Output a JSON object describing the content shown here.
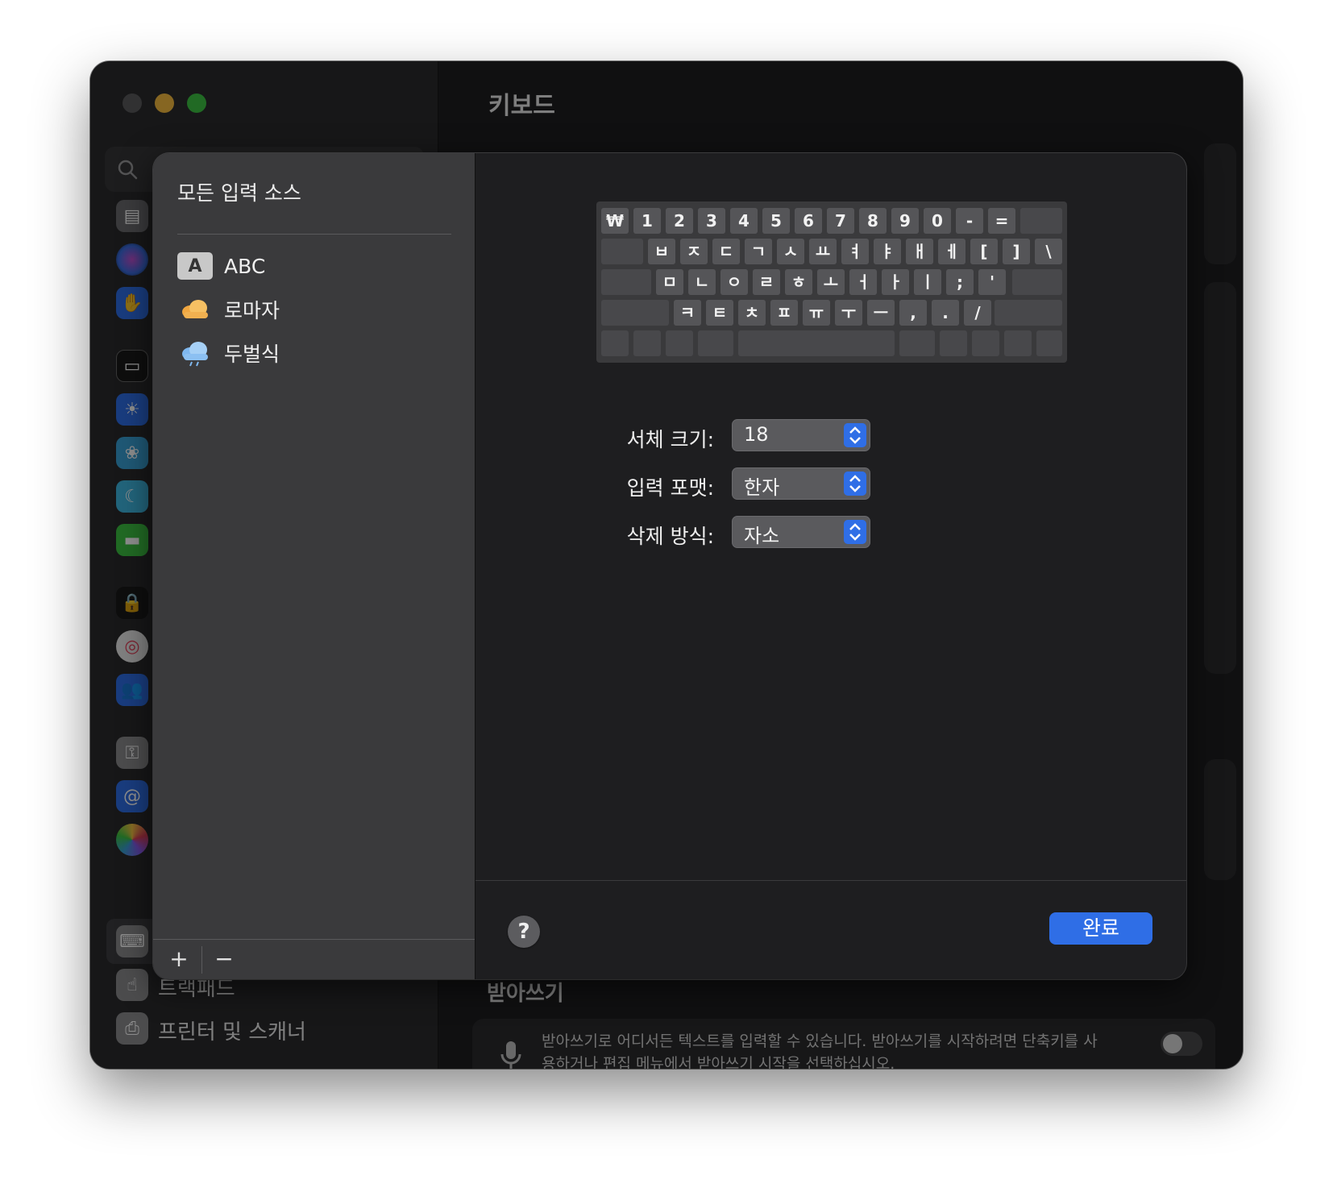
{
  "window": {
    "title": "키보드"
  },
  "sidebar": {
    "items": [
      {
        "label": "트랙패드",
        "icon": "trackpad-icon"
      },
      {
        "label": "프린터 및 스캐너",
        "icon": "printer-icon"
      }
    ],
    "selected_icon": "keyboard-icon"
  },
  "dictation": {
    "title": "받아쓰기",
    "description": "받아쓰기로 어디서든 텍스트를 입력할 수 있습니다. 받아쓰기를 시작하려면 단축키를 사용하거나 편집 메뉴에서 받아쓰기 시작을 선택하십시오."
  },
  "sheet": {
    "list_heading": "모든 입력 소스",
    "sources": [
      {
        "label": "ABC",
        "icon": "abc-icon",
        "badge": "A"
      },
      {
        "label": "로마자",
        "icon": "cloud-orange-icon"
      },
      {
        "label": "두벌식",
        "icon": "cloud-blue-icon"
      }
    ],
    "add_label": "+",
    "remove_label": "−",
    "keyboard_rows": [
      [
        "₩",
        "1",
        "2",
        "3",
        "4",
        "5",
        "6",
        "7",
        "8",
        "9",
        "0",
        "-",
        "="
      ],
      [
        "ㅂ",
        "ㅈ",
        "ㄷ",
        "ㄱ",
        "ㅅ",
        "ㅛ",
        "ㅕ",
        "ㅑ",
        "ㅐ",
        "ㅔ",
        "[",
        "]",
        "\\"
      ],
      [
        "ㅁ",
        "ㄴ",
        "ㅇ",
        "ㄹ",
        "ㅎ",
        "ㅗ",
        "ㅓ",
        "ㅏ",
        "ㅣ",
        ";",
        "'"
      ],
      [
        "ㅋ",
        "ㅌ",
        "ㅊ",
        "ㅍ",
        "ㅠ",
        "ㅜ",
        "ㅡ",
        ",",
        ".",
        "/"
      ]
    ],
    "options": [
      {
        "label": "서체 크기:",
        "value": "18"
      },
      {
        "label": "입력 포맷:",
        "value": "한자"
      },
      {
        "label": "삭제 방식:",
        "value": "자소"
      }
    ],
    "help_label": "?",
    "done_label": "완료"
  },
  "colors": {
    "accent": "#2f6ee6",
    "close": "#5a5a5c",
    "minimize": "#f4bb3f",
    "maximize": "#3cc143"
  }
}
